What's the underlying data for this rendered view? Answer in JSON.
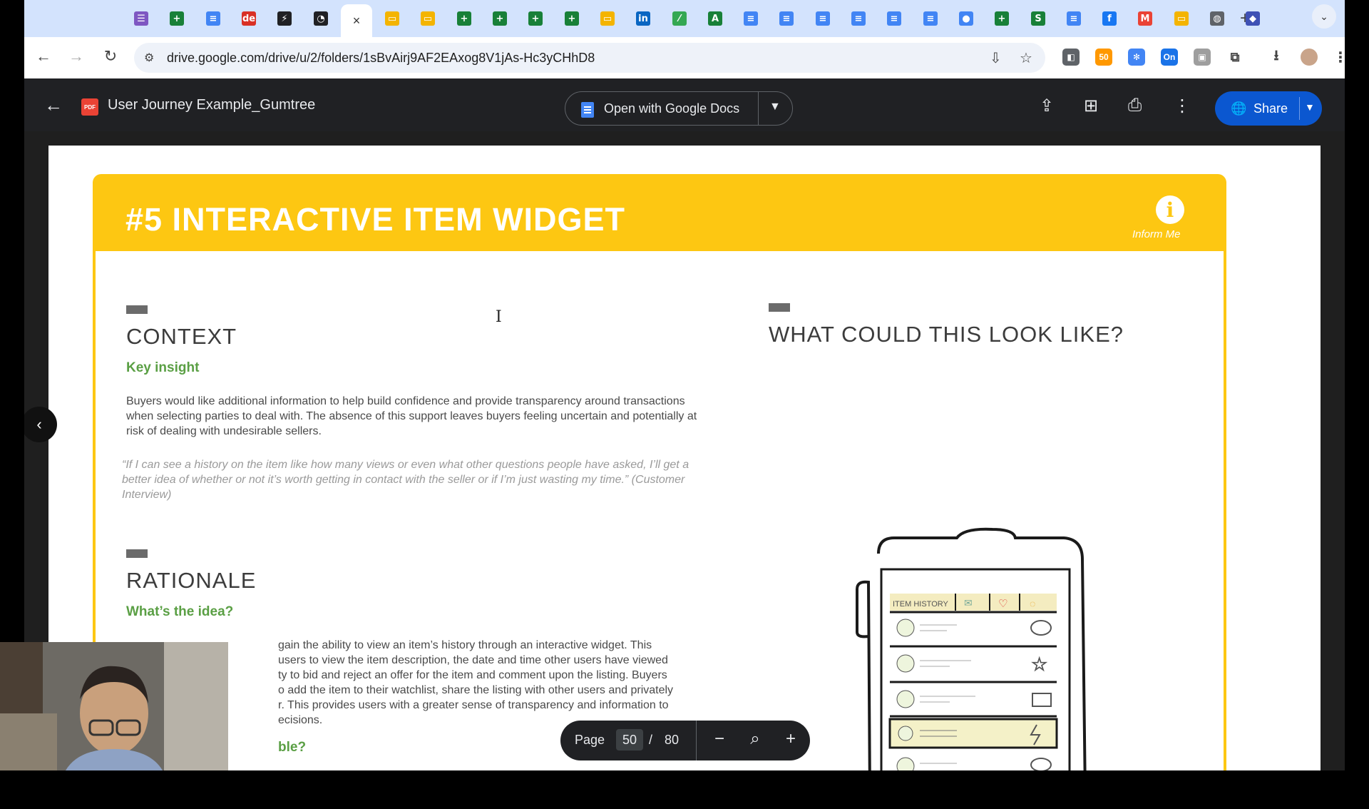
{
  "browser": {
    "url": "drive.google.com/drive/u/2/folders/1sBvAirj9AF2EAxog8V1jAs-Hc3yCHhD8",
    "tabs": [
      {
        "icon": "forms-icon",
        "color": "#7e57c2",
        "glyph": "☰"
      },
      {
        "icon": "sheets-icon",
        "color": "#188038",
        "glyph": "+"
      },
      {
        "icon": "docs-icon",
        "color": "#4285f4",
        "glyph": "≡"
      },
      {
        "icon": "de-icon",
        "color": "#d93025",
        "glyph": "de"
      },
      {
        "icon": "bolt-icon",
        "color": "#202124",
        "glyph": "⚡"
      },
      {
        "icon": "clock-icon",
        "color": "#202124",
        "glyph": "◔"
      },
      {
        "icon": "close-icon",
        "color": "#ffffff",
        "glyph": "×",
        "active": true
      },
      {
        "icon": "slides-icon",
        "color": "#f4b400",
        "glyph": "▭"
      },
      {
        "icon": "slides-icon",
        "color": "#f4b400",
        "glyph": "▭"
      },
      {
        "icon": "sheets-icon",
        "color": "#188038",
        "glyph": "+"
      },
      {
        "icon": "sheets-icon",
        "color": "#188038",
        "glyph": "+"
      },
      {
        "icon": "sheets-icon",
        "color": "#188038",
        "glyph": "+"
      },
      {
        "icon": "sheets-icon",
        "color": "#188038",
        "glyph": "+"
      },
      {
        "icon": "slides-icon",
        "color": "#f4b400",
        "glyph": "▭"
      },
      {
        "icon": "linkedin-icon",
        "color": "#0a66c2",
        "glyph": "in"
      },
      {
        "icon": "leaf-icon",
        "color": "#34a853",
        "glyph": "⁄"
      },
      {
        "icon": "arrow-a-icon",
        "color": "#188038",
        "glyph": "A"
      },
      {
        "icon": "docs-icon",
        "color": "#4285f4",
        "glyph": "≡"
      },
      {
        "icon": "docs-icon",
        "color": "#4285f4",
        "glyph": "≡"
      },
      {
        "icon": "docs-icon",
        "color": "#4285f4",
        "glyph": "≡"
      },
      {
        "icon": "docs-icon",
        "color": "#4285f4",
        "glyph": "≡"
      },
      {
        "icon": "docs-icon",
        "color": "#4285f4",
        "glyph": "≡"
      },
      {
        "icon": "docs-icon",
        "color": "#4285f4",
        "glyph": "≡"
      },
      {
        "icon": "calendar-icon",
        "color": "#4285f4",
        "glyph": "●"
      },
      {
        "icon": "sheets-icon",
        "color": "#188038",
        "glyph": "+"
      },
      {
        "icon": "sites-icon",
        "color": "#188038",
        "glyph": "S"
      },
      {
        "icon": "docs-icon",
        "color": "#4285f4",
        "glyph": "≡"
      },
      {
        "icon": "facebook-icon",
        "color": "#1877f2",
        "glyph": "f"
      },
      {
        "icon": "gmail-icon",
        "color": "#ea4335",
        "glyph": "M"
      },
      {
        "icon": "slides-icon",
        "color": "#f4b400",
        "glyph": "▭"
      },
      {
        "icon": "globe-icon",
        "color": "#5f6368",
        "glyph": "◍"
      },
      {
        "icon": "cube-icon",
        "color": "#3f51b5",
        "glyph": "◆"
      }
    ]
  },
  "viewer": {
    "title": "User Journey Example_Gumtree",
    "pdf_badge": "PDF",
    "open_with": "Open with Google Docs",
    "share": "Share"
  },
  "slide": {
    "banner_title": "#5 INTERACTIVE ITEM WIDGET",
    "info_label": "Inform Me",
    "context": {
      "heading": "CONTEXT",
      "subheading": "Key insight",
      "body": "Buyers would like additional information to help build confidence and provide transparency around transactions when selecting parties to deal with. The absence of this support leaves buyers feeling uncertain and potentially at risk of dealing with undesirable sellers.",
      "quote": "“If I can see a history on the item like how many views or even what other questions people have asked, I’ll get a better idea of whether or not it’s worth getting in contact with the seller or if I’m just wasting my time.” (Customer Interview)"
    },
    "rationale": {
      "heading": "RATIONALE",
      "subheading": "What’s the idea?",
      "lines": [
        "gain the ability to view an item’s history through an interactive widget. This",
        "users to view the item description, the date and time other users have viewed",
        "ty to bid and reject an offer for the item and comment upon the listing. Buyers",
        "o add the item to their watchlist, share the listing with other users and privately",
        "r. This provides users with a greater sense of transparency and information to",
        "ecisions."
      ],
      "next_heading_fragment": "ble?"
    },
    "look_like": {
      "heading": "WHAT COULD THIS LOOK LIKE?"
    },
    "sketch": {
      "tab_label": "ITEM HISTORY"
    }
  },
  "pager": {
    "label": "Page",
    "current": "50",
    "separator": "/",
    "total": "80"
  }
}
